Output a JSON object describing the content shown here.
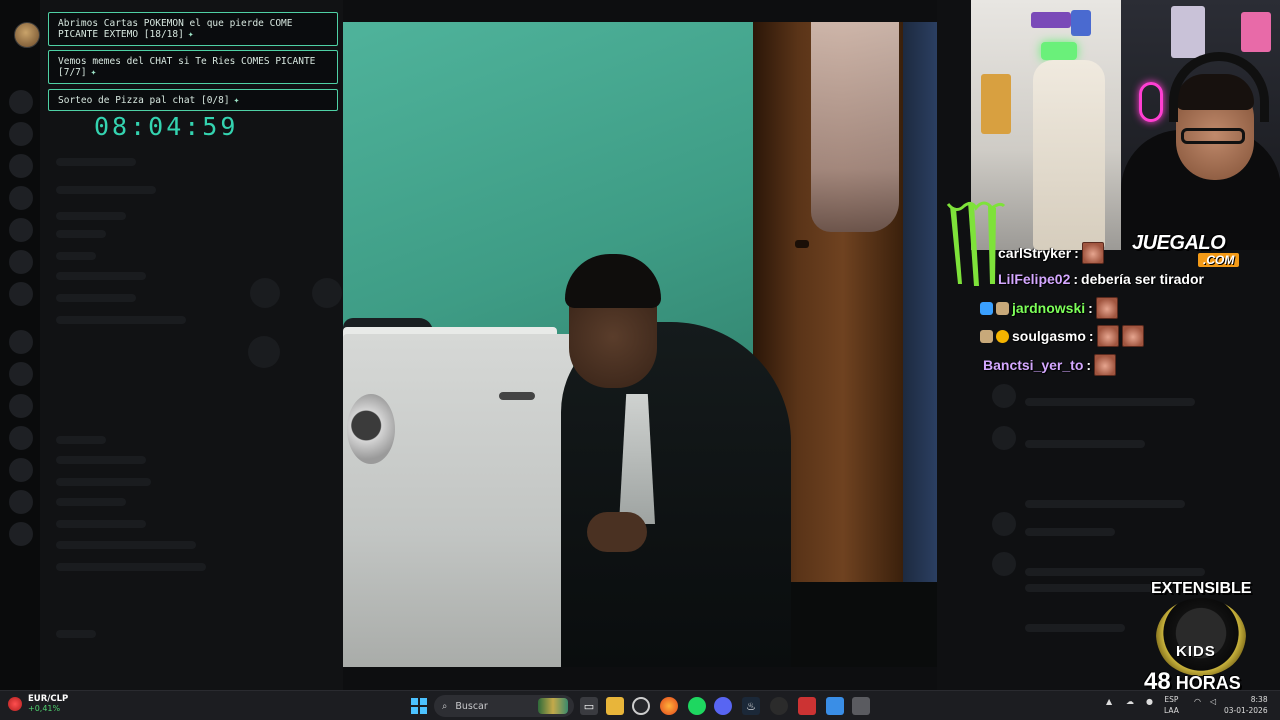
{
  "overlay": {
    "goals": [
      {
        "text": "Abrimos Cartas POKEMON el que pierde COME PICANTE EXTEMO [18/18]",
        "icon": "sparkle-icon"
      },
      {
        "text": "Vemos memes del CHAT si Te Ries COMES PICANTE [7/7]",
        "icon": "sparkle-icon"
      },
      {
        "text": "Sorteo de Pizza pal chat [0/8]",
        "icon": "sparkle-icon"
      }
    ],
    "timer": "08:04:59",
    "accent": "#4fd1a5"
  },
  "branding": {
    "sponsor_name": "JUEGALO",
    "sponsor_tld": ".COM",
    "extensible_title": "EXTENSIBLE",
    "extensible_badge": "KIDS",
    "extensible_hours_num": "48",
    "extensible_hours_label": "HORAS"
  },
  "chat": {
    "messages": [
      {
        "user": "carlStryker",
        "separator": ":",
        "text": "",
        "user_color": "#ffffff",
        "emotes": 1
      },
      {
        "user": "LilFelipe02",
        "separator": ":",
        "text": "debería ser tirador",
        "user_color": "#d4a8ff",
        "emotes": 0
      },
      {
        "user": "jardnowski",
        "separator": ":",
        "text": "",
        "user_color": "#7dff5a",
        "emotes": 1
      },
      {
        "user": "soulgasmo",
        "separator": ":",
        "text": "",
        "user_color": "#ffffff",
        "emotes": 2
      },
      {
        "user": "Banctsi_yer_to",
        "separator": ":",
        "text": "",
        "user_color": "#d4a8ff",
        "emotes": 1
      }
    ]
  },
  "taskbar": {
    "ticker_symbol": "EUR/CLP",
    "ticker_change": "+0,41%",
    "search_placeholder": "Buscar",
    "language_line1": "ESP",
    "language_line2": "LAA",
    "time": "8:38",
    "date": "03-01-2026",
    "pinned_icons": [
      "windows-start-icon",
      "task-view-icon",
      "file-explorer-icon",
      "obs-icon",
      "firefox-icon",
      "spotify-icon",
      "steam-icon",
      "discord-icon",
      "record-icon",
      "store-icon",
      "notepad-icon",
      "snipping-icon"
    ]
  }
}
